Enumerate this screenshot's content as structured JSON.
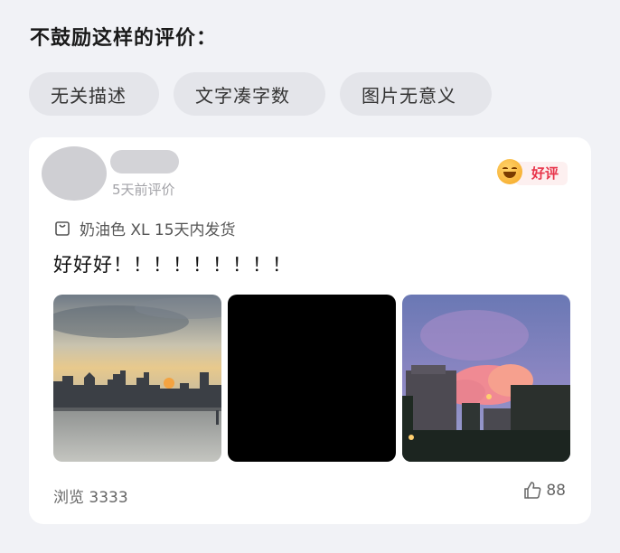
{
  "heading": "不鼓励这样的评价：",
  "chips": [
    "无关描述",
    "文字凑字数",
    "图片无意义"
  ],
  "review": {
    "time": "5天前评价",
    "badge": "好评",
    "spec": "奶油色 XL 15天内发货",
    "text": "好好好！！！！！！！！！",
    "views": "浏览 3333",
    "likes": "88",
    "icons": {
      "bag": "bag-icon",
      "like": "thumbs-up-icon",
      "rating": "smile-emoji-icon"
    },
    "colors": {
      "badge_text": "#e8344a",
      "badge_bg": "#fdf0f0"
    }
  }
}
